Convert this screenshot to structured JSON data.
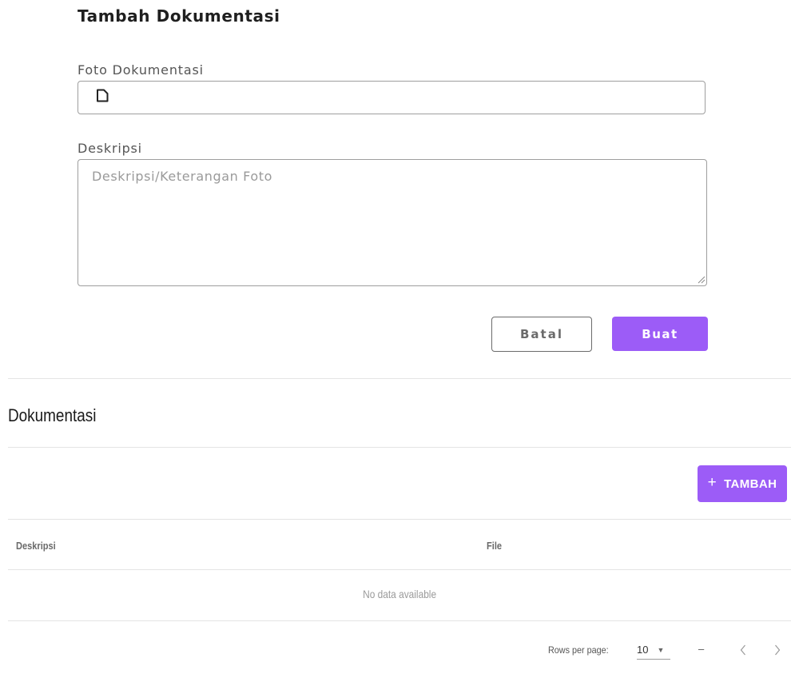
{
  "form": {
    "title": "Tambah Dokumentasi",
    "photo_label": "Foto Dokumentasi",
    "description_label": "Deskripsi",
    "description_placeholder": "Deskripsi/Keterangan Foto",
    "cancel_label": "Batal",
    "submit_label": "Buat"
  },
  "list": {
    "title": "Dokumentasi",
    "add_label": "TAMBAH",
    "columns": [
      "Deskripsi",
      "File"
    ],
    "empty_text": "No data available"
  },
  "pagination": {
    "rows_per_page_label": "Rows per page:",
    "rows_per_page_value": "10",
    "page_range": "–"
  },
  "colors": {
    "accent": "#9c5cf7",
    "border": "#9e9e9e"
  },
  "icons": {
    "file": "file-icon",
    "plus": "plus-icon",
    "dropdown": "caret-down-icon",
    "prev": "chevron-left-icon",
    "next": "chevron-right-icon"
  }
}
